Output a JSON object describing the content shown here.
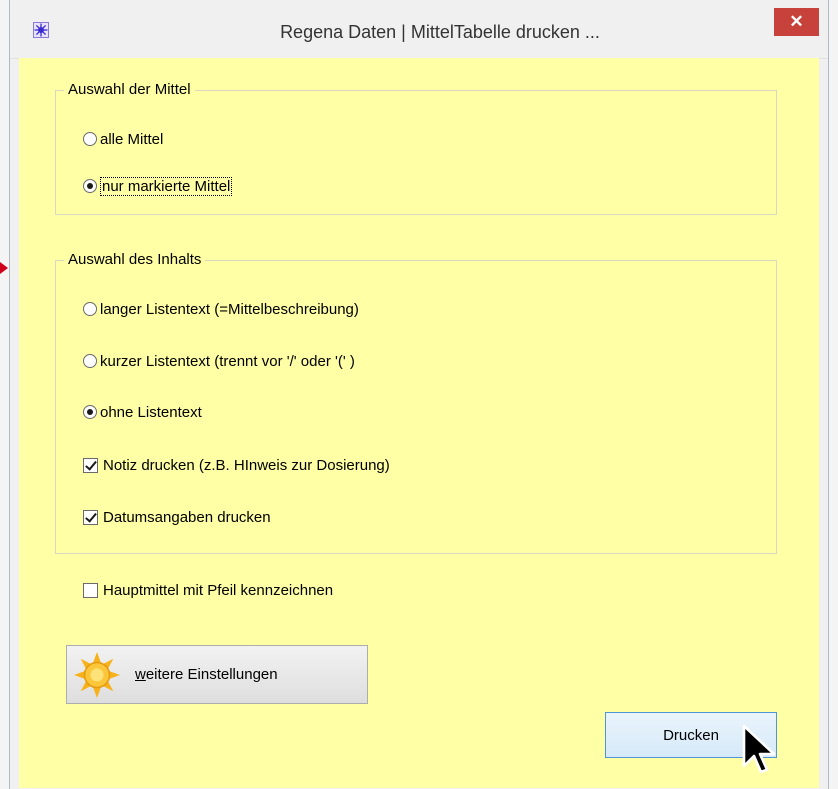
{
  "window": {
    "title": "Regena Daten | MittelTabelle drucken ...",
    "close_glyph": "✕"
  },
  "group_mittel": {
    "title": "Auswahl der Mittel",
    "options": [
      {
        "label": "alle Mittel",
        "checked": false
      },
      {
        "label": "nur markierte Mittel",
        "checked": true
      }
    ]
  },
  "group_inhalt": {
    "title": "Auswahl des Inhalts",
    "options": [
      {
        "label": "langer Listentext (=Mittelbeschreibung)",
        "checked": false
      },
      {
        "label": "kurzer Listentext (trennt vor '/' oder '(' )",
        "checked": false
      },
      {
        "label": "ohne Listentext",
        "checked": true
      }
    ],
    "checkboxes": [
      {
        "label": "Notiz drucken (z.B. HInweis zur Dosierung)",
        "checked": true
      },
      {
        "label": "Datumsangaben drucken",
        "checked": true
      }
    ]
  },
  "hauptmittel": {
    "label": "Hauptmittel mit Pfeil kennzeichnen",
    "checked": false
  },
  "settings_button": {
    "mnemonic": "w",
    "label_rest": "eitere Einstellungen"
  },
  "print_button": {
    "label": "Drucken"
  },
  "colors": {
    "client_background": "#ffffa6",
    "close_button": "#c7423b",
    "print_button_border": "#4f95d3"
  }
}
